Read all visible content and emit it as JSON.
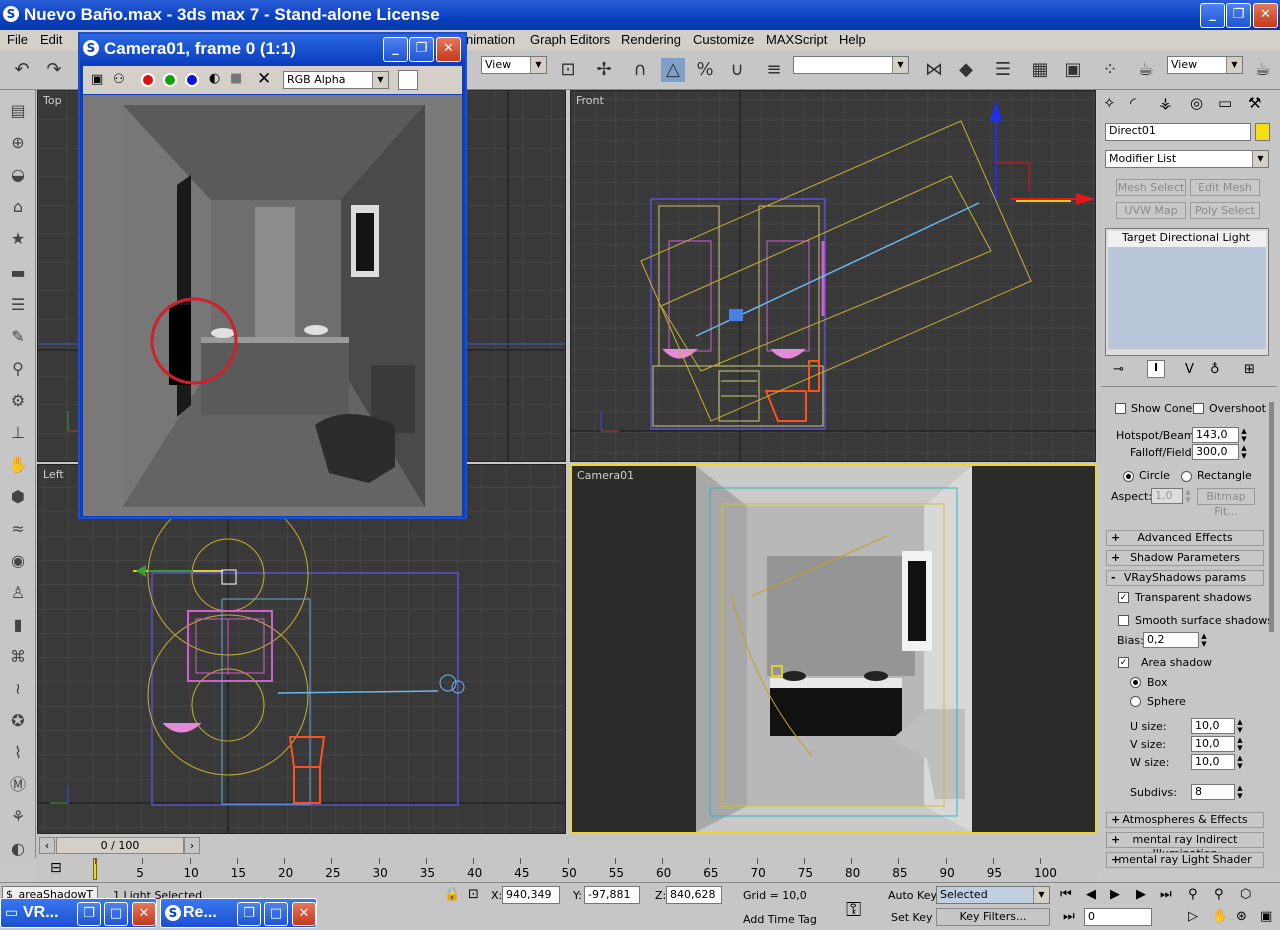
{
  "window": {
    "title": "Nuevo Baño.max - 3ds max 7  - Stand-alone License"
  },
  "menu": [
    "File",
    "Edit",
    "nimation",
    "Graph Editors",
    "Rendering",
    "Customize",
    "MAXScript",
    "Help"
  ],
  "toolbar": {
    "view_left": "View",
    "view_right": "View"
  },
  "render_window": {
    "title": "Camera01, frame 0 (1:1)",
    "channel": "RGB Alpha"
  },
  "viewports": {
    "top": "Top",
    "front": "Front",
    "left": "Left",
    "camera": "Camera01"
  },
  "command_panel": {
    "object_name": "Direct01",
    "object_color": "#f4e010",
    "modifier_list": "Modifier List",
    "mod_buttons": [
      "Mesh Select",
      "Edit Mesh",
      "UVW Map",
      "Poly Select"
    ],
    "stack_item": "Target Directional Light",
    "show_cone": "Show Cone",
    "overshoot": "Overshoot",
    "hotspot_label": "Hotspot/Beam:",
    "hotspot_value": "143,0",
    "falloff_label": "Falloff/Field:",
    "falloff_value": "300,0",
    "circle": "Circle",
    "rectangle": "Rectangle",
    "aspect_label": "Aspect:",
    "aspect_value": "1,0",
    "bitmap_fit": "Bitmap Fit...",
    "rollouts": {
      "advanced": "Advanced Effects",
      "shadow_params": "Shadow Parameters",
      "vray": "VRayShadows params",
      "atmos": "Atmospheres & Effects",
      "mr_gi": "mental ray Indirect Illumination",
      "mr_shader": "mental ray Light Shader"
    },
    "transparent": "Transparent shadows",
    "smooth": "Smooth surface shadows",
    "bias_label": "Bias:",
    "bias_value": "0,2",
    "area_shadow": "Area shadow",
    "box": "Box",
    "sphere": "Sphere",
    "u_label": "U size:",
    "u_value": "10,0",
    "v_label": "V size:",
    "v_value": "10,0",
    "w_label": "W size:",
    "w_value": "10,0",
    "subdivs_label": "Subdivs:",
    "subdivs_value": "8"
  },
  "timeline": {
    "frame_counter": "0 / 100",
    "ticks": [
      "5",
      "10",
      "15",
      "20",
      "25",
      "30",
      "35",
      "40",
      "45",
      "50",
      "55",
      "60",
      "65",
      "70",
      "75",
      "80",
      "85",
      "90",
      "95",
      "100"
    ]
  },
  "status": {
    "script_field": "$_areaShadowT",
    "selection": "1 Light Selected",
    "x_label": "X:",
    "x": "940,349",
    "y_label": "Y:",
    "y": "-97,881",
    "z_label": "Z:",
    "z": "840,628",
    "grid": "Grid = 10,0",
    "add_time_tag": "Add Time Tag",
    "auto_key": "Auto Key",
    "set_key": "Set Key",
    "selected": "Selected",
    "key_filters": "Key Filters...",
    "frame": "0"
  },
  "taskbar": [
    {
      "label": "VR..."
    },
    {
      "label": "Re..."
    }
  ]
}
